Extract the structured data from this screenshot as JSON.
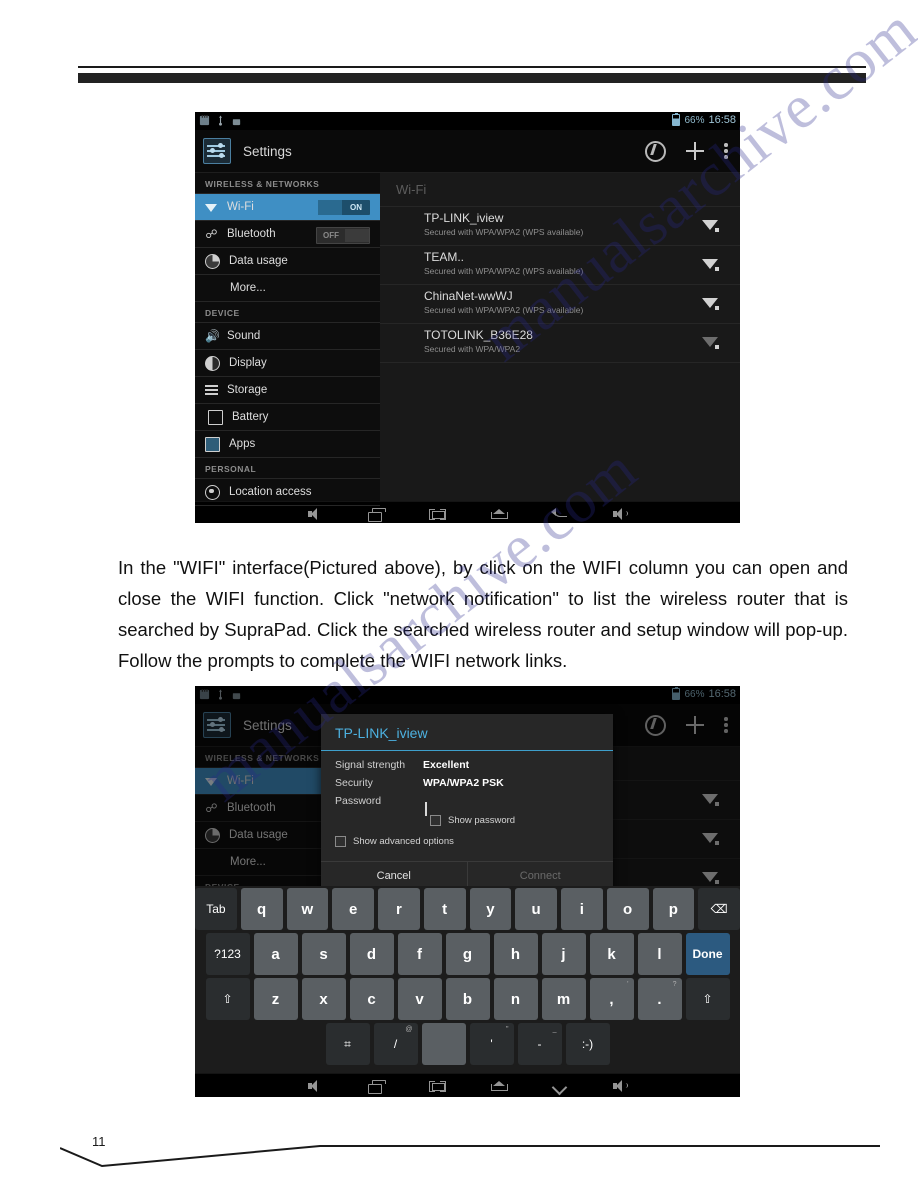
{
  "document": {
    "page_number": "11",
    "paragraph": "In the \"WIFI\" interface(Pictured above), by click on the WIFI column you can open and close the WIFI function. Click \"network notification\" to list the wireless router that is searched by SupraPad. Click the searched wireless router and setup window will pop-up. Follow the prompts to complete the WIFI network links.",
    "watermark": "manualsarchive.com"
  },
  "screenshot1": {
    "status_bar": {
      "icons": [
        "sd-card-icon",
        "usb-icon",
        "android-debug-icon"
      ],
      "battery_percent": "66%",
      "time": "16:58"
    },
    "action_bar": {
      "title": "Settings",
      "icons": [
        "wps-icon",
        "add-network-icon",
        "overflow-menu-icon"
      ]
    },
    "sidebar": {
      "sections": [
        {
          "header": "WIRELESS & NETWORKS",
          "items": [
            {
              "label": "Wi-Fi",
              "icon": "wifi-icon",
              "selected": true,
              "toggle": "ON"
            },
            {
              "label": "Bluetooth",
              "icon": "bluetooth-icon",
              "selected": false,
              "toggle": "OFF"
            },
            {
              "label": "Data usage",
              "icon": "data-usage-icon",
              "selected": false
            },
            {
              "label": "More...",
              "icon": "",
              "selected": false
            }
          ]
        },
        {
          "header": "DEVICE",
          "items": [
            {
              "label": "Sound",
              "icon": "sound-icon",
              "selected": false
            },
            {
              "label": "Display",
              "icon": "display-icon",
              "selected": false
            },
            {
              "label": "Storage",
              "icon": "storage-icon",
              "selected": false
            },
            {
              "label": "Battery",
              "icon": "battery-icon",
              "selected": false
            },
            {
              "label": "Apps",
              "icon": "apps-icon",
              "selected": false
            }
          ]
        },
        {
          "header": "PERSONAL",
          "items": [
            {
              "label": "Location access",
              "icon": "location-icon",
              "selected": false
            }
          ]
        }
      ]
    },
    "wifi_pane": {
      "title": "Wi-Fi",
      "networks": [
        {
          "ssid": "TP-LINK_iview",
          "security": "Secured with WPA/WPA2 (WPS available)",
          "signal": "strong"
        },
        {
          "ssid": "TEAM..",
          "security": "Secured with WPA/WPA2 (WPS available)",
          "signal": "strong"
        },
        {
          "ssid": "ChinaNet-wwWJ",
          "security": "Secured with WPA/WPA2 (WPS available)",
          "signal": "strong"
        },
        {
          "ssid": "TOTOLINK_B36E28",
          "security": "Secured with WPA/WPA2",
          "signal": "weak"
        }
      ]
    },
    "nav_bar": [
      "volume-down-icon",
      "recents-icon",
      "screenshot-icon",
      "home-icon",
      "back-icon",
      "volume-up-icon"
    ]
  },
  "screenshot2": {
    "status_bar": {
      "battery_percent": "66%",
      "time": "16:58"
    },
    "action_bar": {
      "title": "Settings"
    },
    "dialog": {
      "title": "TP-LINK_iview",
      "signal_strength_label": "Signal strength",
      "signal_strength_value": "Excellent",
      "security_label": "Security",
      "security_value": "WPA/WPA2 PSK",
      "password_label": "Password",
      "password_value": "",
      "show_password_label": "Show password",
      "show_advanced_label": "Show advanced options",
      "cancel_label": "Cancel",
      "connect_label": "Connect"
    },
    "keyboard": {
      "row1": [
        "Tab",
        "q",
        "w",
        "e",
        "r",
        "t",
        "y",
        "u",
        "i",
        "o",
        "p",
        "⌫"
      ],
      "row2": [
        "?123",
        "a",
        "s",
        "d",
        "f",
        "g",
        "h",
        "j",
        "k",
        "l",
        "Done"
      ],
      "row3": [
        "⇧",
        "z",
        "x",
        "c",
        "v",
        "b",
        "n",
        "m",
        ",",
        ".",
        "⇧"
      ],
      "row3_sup": [
        "",
        "",
        "",
        "",
        "",
        "",
        "",
        "",
        "'",
        "?",
        ""
      ],
      "row4": [
        "⌗",
        "/",
        "",
        "'",
        "-",
        ":-)"
      ],
      "row4_sup": [
        "",
        "@",
        "",
        "\"",
        "_",
        ""
      ]
    },
    "nav_bar": [
      "volume-down-icon",
      "recents-icon",
      "screenshot-icon",
      "home-icon",
      "hide-keyboard-icon",
      "volume-up-icon"
    ]
  }
}
